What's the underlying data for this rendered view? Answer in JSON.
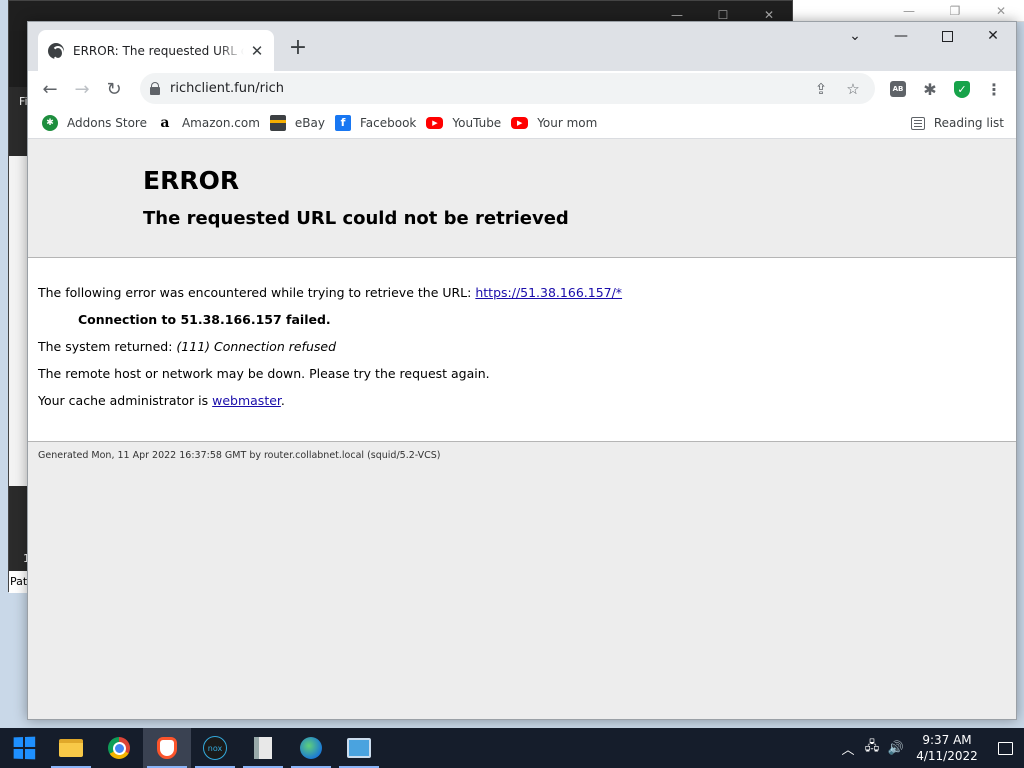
{
  "browser": {
    "tab": {
      "title": "ERROR: The requested URL could not be retrieved",
      "close_label": "✕"
    },
    "new_tab_label": "+",
    "url": "richclient.fun/rich",
    "bookmarks": [
      {
        "label": "Addons Store",
        "icon": "addons-store-icon"
      },
      {
        "label": "Amazon.com",
        "icon": "amazon-icon"
      },
      {
        "label": "eBay",
        "icon": "ebay-icon"
      },
      {
        "label": "Facebook",
        "icon": "facebook-icon"
      },
      {
        "label": "YouTube",
        "icon": "youtube-icon"
      },
      {
        "label": "Your mom",
        "icon": "youtube-icon"
      }
    ],
    "reading_list_label": "Reading list"
  },
  "page": {
    "heading": "ERROR",
    "subheading": "The requested URL could not be retrieved",
    "intro_text": "The following error was encountered while trying to retrieve the URL: ",
    "intro_link": "https://51.38.166.157/*",
    "failure": "Connection to 51.38.166.157 failed.",
    "system_prefix": "The system returned: ",
    "system_error": "(111) Connection refused",
    "remote_note": "The remote host or network may be down. Please try the request again.",
    "admin_prefix": "Your cache administrator is ",
    "admin_link": "webmaster",
    "admin_suffix": ".",
    "footer": "Generated Mon, 11 Apr 2022 16:37:58 GMT by router.collabnet.local (squid/5.2-VCS)"
  },
  "background_window": {
    "side_label_top": "Fi",
    "side_label_mid": "1",
    "side_label_bottom": "Pat"
  },
  "taskbar": {
    "apps": [
      "file-explorer",
      "chrome",
      "brave",
      "nox",
      "book",
      "globe",
      "monitor"
    ],
    "clock_time": "9:37 AM",
    "clock_date": "4/11/2022"
  },
  "colors": {
    "link": "#1a0dab",
    "tabstrip": "#dee1e6",
    "taskbar": "#151d2b"
  }
}
